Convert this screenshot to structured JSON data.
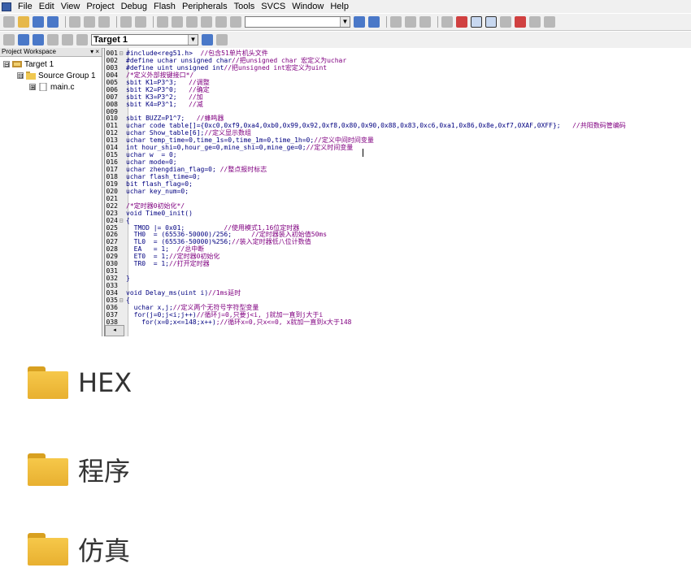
{
  "menubar": {
    "items": [
      "File",
      "Edit",
      "View",
      "Project",
      "Debug",
      "Flash",
      "Peripherals",
      "Tools",
      "SVCS",
      "Window",
      "Help"
    ]
  },
  "toolbar2": {
    "target": "Target 1"
  },
  "workspace": {
    "title": "Project Workspace",
    "controls": "▾ ×",
    "tree": [
      {
        "label": "Target 1",
        "expander": "⊟"
      },
      {
        "label": "Source Group 1",
        "expander": "⊟"
      },
      {
        "label": "main.c",
        "expander": "⊞"
      }
    ]
  },
  "code": [
    {
      "n": "001",
      "f": "⊟",
      "t": "#include<reg51.h>",
      "c": "  //包含51单片机头文件"
    },
    {
      "n": "002",
      "f": "",
      "t": "#define uchar unsigned char",
      "c": "//把unsigned char 宏定义为uchar"
    },
    {
      "n": "003",
      "f": "",
      "t": "#define uint unsigned int",
      "c": "//把unsigned int宏定义为uint"
    },
    {
      "n": "004",
      "f": "",
      "t": "",
      "c": "/*定义外部按键接口*/"
    },
    {
      "n": "005",
      "f": "",
      "t": "sbit K1=P3^3;",
      "c": "   //调整"
    },
    {
      "n": "006",
      "f": "",
      "t": "sbit K2=P3^0;",
      "c": "   //确定"
    },
    {
      "n": "007",
      "f": "",
      "t": "sbit K3=P3^2;",
      "c": "   //加"
    },
    {
      "n": "008",
      "f": "",
      "t": "sbit K4=P3^1;",
      "c": "   //减"
    },
    {
      "n": "009",
      "f": "",
      "t": "",
      "c": ""
    },
    {
      "n": "010",
      "f": "",
      "t": "sbit BUZZ=P1^7;",
      "c": "   //蜂鸣器"
    },
    {
      "n": "011",
      "f": "",
      "t": "uchar code table[]={0xc0,0xf9,0xa4,0xb0,0x99,0x92,0xf8,0x80,0x90,0x88,0x83,0xc6,0xa1,0x86,0x8e,0xf7,0XAF,0XFF};",
      "c": "   //共阳数码管编码"
    },
    {
      "n": "012",
      "f": "",
      "t": "uchar Show_table[6];",
      "c": "//定义显示数组"
    },
    {
      "n": "013",
      "f": "",
      "t": "uchar temp_time=0,time_1s=0,time_1m=0,time_1h=0;",
      "c": "//定义中间时间变量"
    },
    {
      "n": "014",
      "f": "",
      "t": "int hour_shi=0,hour_ge=0,mine_shi=0,mine_ge=0;",
      "c": "//定义时间变量"
    },
    {
      "n": "015",
      "f": "",
      "t": "uchar w  = 0;",
      "c": ""
    },
    {
      "n": "016",
      "f": "",
      "t": "uchar mode=0;",
      "c": ""
    },
    {
      "n": "017",
      "f": "",
      "t": "uchar zhengdian_flag=0;",
      "c": " //整点报时标志"
    },
    {
      "n": "018",
      "f": "",
      "t": "uchar flash_time=0;",
      "c": ""
    },
    {
      "n": "019",
      "f": "",
      "t": "bit flash_flag=0;",
      "c": ""
    },
    {
      "n": "020",
      "f": "",
      "t": "uchar key_num=0;",
      "c": ""
    },
    {
      "n": "021",
      "f": "",
      "t": "",
      "c": ""
    },
    {
      "n": "022",
      "f": "",
      "t": "",
      "c": "/*定时器0初始化*/"
    },
    {
      "n": "023",
      "f": "",
      "t": "void Time0_init()",
      "c": ""
    },
    {
      "n": "024",
      "f": "⊟",
      "t": "{",
      "c": ""
    },
    {
      "n": "025",
      "f": "",
      "t": "  TMOD |= 0x01;",
      "c": "          //使用模式1,16位定时器"
    },
    {
      "n": "026",
      "f": "",
      "t": "  TH0  = (65536-50000)/256;",
      "c": "     //定时器装入初始值50ms"
    },
    {
      "n": "027",
      "f": "",
      "t": "  TL0  = (65536-50000)%256;",
      "c": "//装入定时器低八位计数值"
    },
    {
      "n": "028",
      "f": "",
      "t": "  EA   = 1;",
      "c": "  //总中断"
    },
    {
      "n": "029",
      "f": "",
      "t": "  ET0  = 1;",
      "c": "//定时器0初始化"
    },
    {
      "n": "030",
      "f": "",
      "t": "  TR0  = 1;",
      "c": "//打开定时器"
    },
    {
      "n": "031",
      "f": "",
      "t": "",
      "c": ""
    },
    {
      "n": "032",
      "f": "",
      "t": "}",
      "c": ""
    },
    {
      "n": "033",
      "f": "",
      "t": "",
      "c": ""
    },
    {
      "n": "034",
      "f": "",
      "t": "void Delay_ms(uint i)",
      "c": "//1ms延时"
    },
    {
      "n": "035",
      "f": "⊟",
      "t": "{",
      "c": ""
    },
    {
      "n": "036",
      "f": "",
      "t": "  uchar x,j;",
      "c": "//定义两个无符号字符型变量"
    },
    {
      "n": "037",
      "f": "",
      "t": "  for(j=0;j<i;j++)",
      "c": "//循环j=0,只要j<i, j就加一直到j大于i"
    },
    {
      "n": "038",
      "f": "",
      "t": "    for(x=0;x<=148;x++)",
      "c": ";//循环x=0,只x<=0, x就加一直到x大于148"
    }
  ],
  "scroll_label": "◂",
  "folders": [
    {
      "label": "HEX"
    },
    {
      "label": "程序"
    },
    {
      "label": "仿真"
    }
  ]
}
